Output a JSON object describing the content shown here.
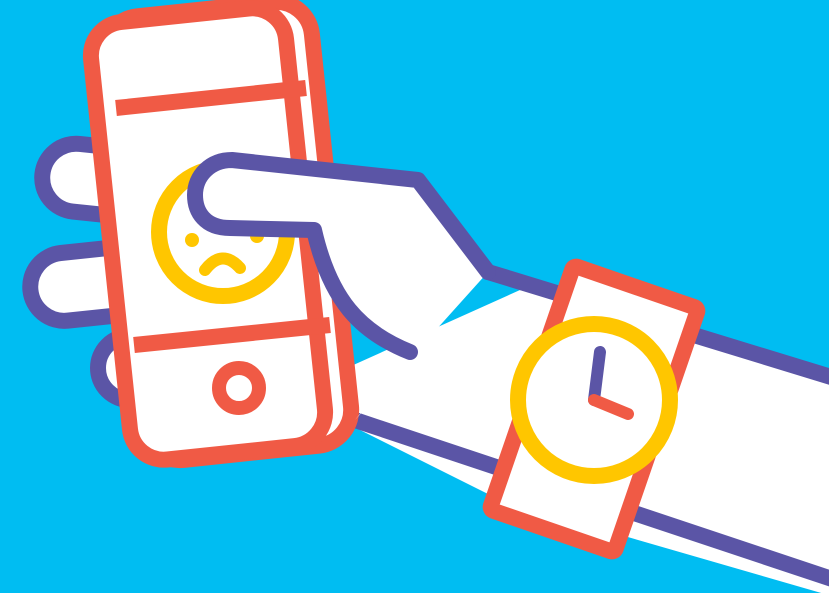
{
  "illustration": {
    "subject": "hand-holding-phone-with-sad-face-and-wristwatch",
    "icons": [
      "phone-icon",
      "sad-face-icon",
      "hand-icon",
      "wristwatch-icon",
      "clock-icon"
    ],
    "colors": {
      "background": "#00BDF2",
      "hand_outline": "#5B55A6",
      "phone_outline": "#F05A45",
      "accent_yellow": "#FFC600",
      "fill": "#FFFFFF"
    }
  }
}
